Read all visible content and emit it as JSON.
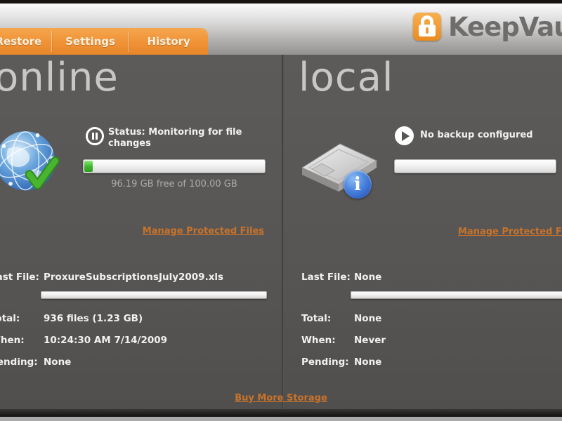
{
  "header": {
    "logo_text": "KeepVault",
    "tabs": [
      {
        "label": "Restore"
      },
      {
        "label": "Settings"
      },
      {
        "label": "History"
      }
    ]
  },
  "online": {
    "title": "online",
    "status_text": "Status: Monitoring for file changes",
    "used_percent": 4.5,
    "free_text": "96.19 GB free of 100.00 GB",
    "manage_link_label": "Manage Protected Files",
    "details": {
      "last_file_label": "Last File:",
      "last_file": "ProxureSubscriptionsJuly2009.xls",
      "total_label": "Total:",
      "total": "936 files (1.23 GB)",
      "when_label": "When:",
      "when": "10:24:30 AM 7/14/2009",
      "pending_label": "Pending:",
      "pending": "None"
    }
  },
  "local": {
    "title": "local",
    "status_text": "No backup configured",
    "used_percent": 0,
    "manage_link_label": "Manage Protected Files",
    "details": {
      "last_file_label": "Last File:",
      "last_file": "None",
      "total_label": "Total:",
      "total": "None",
      "when_label": "When:",
      "when": "Never",
      "pending_label": "Pending:",
      "pending": "None"
    }
  },
  "footer": {
    "buy_more_label": "Buy More Storage"
  },
  "colors": {
    "tab_orange": "#ef9236",
    "link_orange": "#c8732b",
    "progress_green": "#3db52c",
    "panel_background": "#585654",
    "title_gray": "#c9c7c5"
  }
}
